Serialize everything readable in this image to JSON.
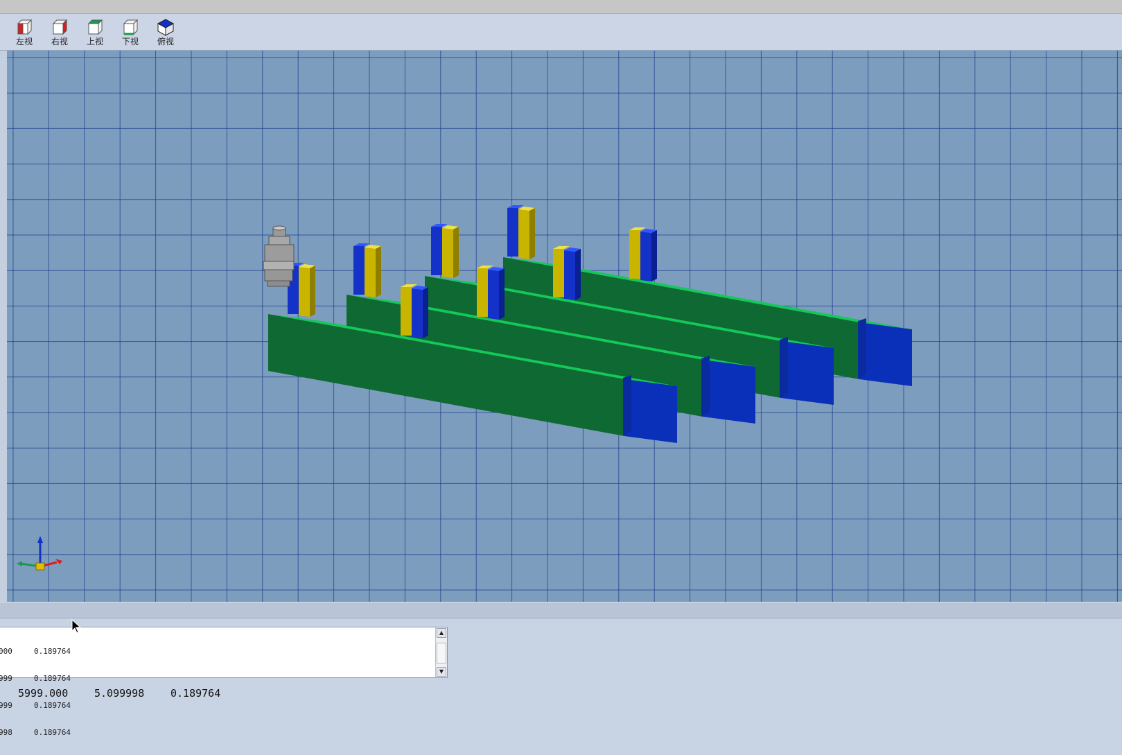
{
  "toolbar": {
    "buttons": [
      {
        "label": "左视",
        "icon": "left-view-cube-icon"
      },
      {
        "label": "右视",
        "icon": "right-view-cube-icon"
      },
      {
        "label": "上视",
        "icon": "top-view-cube-icon"
      },
      {
        "label": "下视",
        "icon": "bottom-view-cube-icon"
      },
      {
        "label": "俯视",
        "icon": "overhead-view-cube-icon"
      }
    ]
  },
  "viewport": {
    "background": "#7d9dbe",
    "grid_color": "#1c3f8c",
    "conveyor_top_color": "#14c85a",
    "conveyor_side_color": "#0e6a32",
    "end_cap_color": "#0a2fb8",
    "pin_yellow": "#c9b400",
    "pin_blue": "#1432c8",
    "axis_gizmo_icon": "xyz-axis-triad-icon",
    "spindle_icon": "spindle-tool-icon"
  },
  "log": {
    "lines": [
      {
        "col1": "000",
        "col2": "0.189764"
      },
      {
        "col1": "999",
        "col2": "0.189764"
      },
      {
        "col1": "999",
        "col2": "0.189764"
      },
      {
        "col1": "998",
        "col2": "0.189764"
      }
    ]
  },
  "status": {
    "x": "5999.000",
    "y": "5.099998",
    "z": "0.189764"
  }
}
